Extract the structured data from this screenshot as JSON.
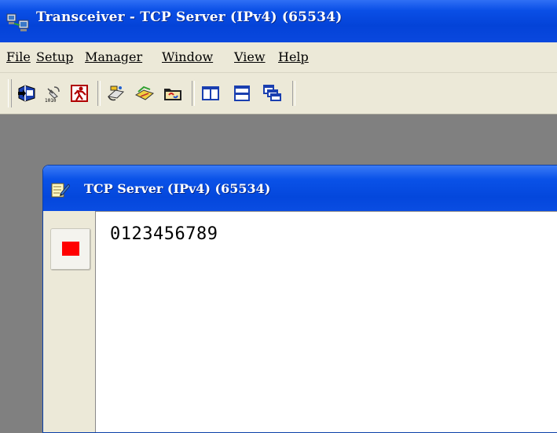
{
  "window": {
    "title": "Transceiver - TCP Server (IPv4) (65534)"
  },
  "menu": {
    "items": [
      {
        "label": "File"
      },
      {
        "label": "Setup"
      },
      {
        "label": "Manager"
      },
      {
        "label": "Window"
      },
      {
        "label": "View"
      },
      {
        "label": "Help"
      }
    ]
  },
  "toolbar": {
    "buttons": [
      {
        "icon": "open-connection-icon"
      },
      {
        "icon": "satellite-settings-icon"
      },
      {
        "icon": "exit-icon"
      },
      {
        "icon": "send-file-icon"
      },
      {
        "icon": "receive-file-icon"
      },
      {
        "icon": "folder-refresh-icon"
      },
      {
        "icon": "tile-vertical-icon"
      },
      {
        "icon": "tile-horizontal-icon"
      },
      {
        "icon": "cascade-icon"
      }
    ]
  },
  "child_window": {
    "title": "TCP Server (IPv4) (65534)",
    "stop_button": {
      "icon": "stop-square-icon",
      "color": "#ff0000"
    },
    "content": "0123456789"
  },
  "colors": {
    "titlebar_blue": "#0443d8",
    "face": "#ece9d8",
    "mdi_background": "#808080"
  }
}
